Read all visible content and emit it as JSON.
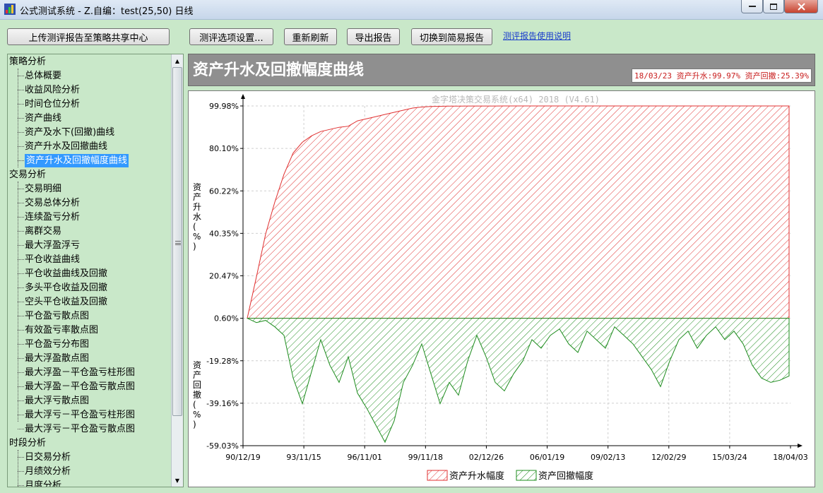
{
  "window": {
    "title": "公式测试系统 - Z.自编：test(25,50) 日线"
  },
  "toolbar": {
    "upload": "上传测评报告至策略共享中心",
    "options": "测评选项设置...",
    "refresh": "重新刷新",
    "export": "导出报告",
    "simple": "切换到简易报告",
    "help": "测评报告使用说明"
  },
  "tree": {
    "cat1": "策略分析",
    "cat1_items": [
      "总体概要",
      "收益风险分析",
      "时间仓位分析",
      "资产曲线",
      "资产及水下(回撤)曲线",
      "资产升水及回撤曲线",
      "资产升水及回撤幅度曲线"
    ],
    "cat2": "交易分析",
    "cat2_items": [
      "交易明细",
      "交易总体分析",
      "连续盈亏分析",
      "离群交易",
      "最大浮盈浮亏",
      "平仓收益曲线",
      "平仓收益曲线及回撤",
      "多头平仓收益及回撤",
      "空头平仓收益及回撤",
      "平仓盈亏散点图",
      "有效盈亏率散点图",
      "平仓盈亏分布图",
      "最大浮盈散点图",
      "最大浮盈－平仓盈亏柱形图",
      "最大浮盈－平仓盈亏散点图",
      "最大浮亏散点图",
      "最大浮亏－平仓盈亏柱形图",
      "最大浮亏－平仓盈亏散点图"
    ],
    "cat3": "时段分析",
    "cat3_items": [
      "日交易分析",
      "月绩效分析",
      "月度分析"
    ]
  },
  "header": {
    "title": "资产升水及回撤幅度曲线",
    "summary": "18/03/23 资产升水:99.97%  资产回撤:25.39%"
  },
  "chart_data": {
    "type": "area",
    "watermark": "金字塔决策交易系统(x64) 2018 (V4.61)",
    "ylabel_upper": "资产升水(%)",
    "ylabel_lower": "资产回撤(%)",
    "y_ticks": [
      "99.98%",
      "80.10%",
      "60.22%",
      "40.35%",
      "20.47%",
      "0.60%",
      "-19.28%",
      "-39.16%",
      "-59.03%"
    ],
    "x_ticks": [
      "90/12/19",
      "93/11/15",
      "96/11/01",
      "99/11/18",
      "02/12/26",
      "06/01/19",
      "09/02/13",
      "12/02/29",
      "15/03/24",
      "18/04/03"
    ],
    "ylim": [
      -59.03,
      99.98
    ],
    "series": [
      {
        "name": "资产升水幅度",
        "color": "#e03030",
        "values": [
          0.6,
          20,
          40,
          55,
          68,
          78,
          83,
          86,
          88,
          89,
          90,
          90.5,
          93,
          94,
          95,
          96,
          97,
          98,
          99,
          99.5,
          99.7,
          99.8,
          99.9,
          99.9,
          99.95,
          99.95,
          99.96,
          99.96,
          99.97,
          99.97,
          99.97,
          99.97,
          99.97,
          99.97,
          99.97,
          99.97,
          99.97,
          99.97,
          99.97,
          99.97,
          99.97,
          99.97,
          99.97,
          99.97,
          99.97,
          99.97,
          99.97,
          99.97,
          99.97,
          99.97,
          99.97,
          99.97,
          99.97,
          99.97,
          99.97,
          99.97,
          99.97,
          99.97,
          99.97,
          99.97
        ]
      },
      {
        "name": "资产回撤幅度",
        "color": "#1e8c1e",
        "values": [
          0,
          -2,
          -1,
          -4,
          -8,
          -28,
          -40,
          -25,
          -10,
          -22,
          -30,
          -18,
          -35,
          -42,
          -50,
          -58,
          -48,
          -30,
          -22,
          -12,
          -26,
          -40,
          -30,
          -36,
          -20,
          -8,
          -18,
          -30,
          -34,
          -26,
          -20,
          -10,
          -14,
          -8,
          -5,
          -12,
          -16,
          -6,
          -10,
          -14,
          -4,
          -8,
          -12,
          -18,
          -24,
          -32,
          -20,
          -10,
          -6,
          -14,
          -8,
          -4,
          -10,
          -6,
          -12,
          -22,
          -28,
          -30,
          -29,
          -27
        ]
      }
    ]
  }
}
